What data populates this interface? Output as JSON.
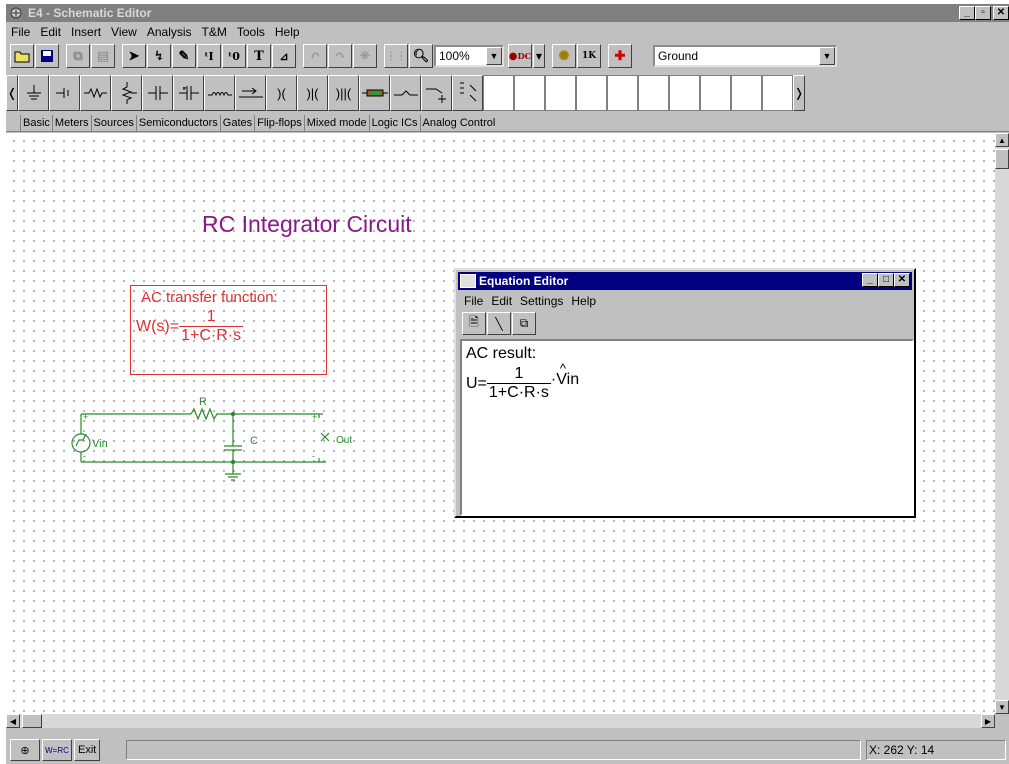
{
  "window": {
    "title": "E4 - Schematic Editor"
  },
  "menu": [
    "File",
    "Edit",
    "Insert",
    "View",
    "Analysis",
    "T&M",
    "Tools",
    "Help"
  ],
  "toolbar": {
    "zoom": "100%",
    "component_select": "Ground",
    "icon_names": [
      "open-icon",
      "save-icon",
      "copy-icon",
      "paste-icon",
      "select-arrow-icon",
      "wire-icon",
      "pen-icon",
      "text-subscript-icon",
      "text-zero-icon",
      "text-icon",
      "ac-source-icon",
      "undo-icon",
      "redo-icon",
      "crosshair-icon",
      "grid-icon",
      "zoom-icon",
      "dc-analysis-icon",
      "transient-icon",
      "kilo-icon",
      "probe-icon"
    ]
  },
  "component_tabs": [
    "Basic",
    "Meters",
    "Sources",
    "Semiconductors",
    "Gates",
    "Flip-flops",
    "Mixed mode",
    "Logic ICs",
    "Analog Control"
  ],
  "schematic": {
    "title": "RC Integrator Circuit",
    "transfer_box": {
      "heading": "AC transfer function:",
      "lhs": "W(s)=",
      "numerator": "1",
      "denominator": "1+C·R·s"
    },
    "labels": {
      "resistor": "R",
      "capacitor": "C",
      "source": "Vin",
      "output": "Out",
      "plus": "+",
      "minus": "-"
    }
  },
  "equation_editor": {
    "title": "Equation Editor",
    "menu": [
      "File",
      "Edit",
      "Settings",
      "Help"
    ],
    "result_label": "AC result:",
    "lhs": "U=",
    "numerator": "1",
    "denominator": "1+C·R·s",
    "factor": "·Vin",
    "hat": "^"
  },
  "statusbar": {
    "exit_label": "Exit",
    "coord": "X: 262  Y: 14",
    "formula_icon_text": "RC"
  },
  "colors": {
    "title": "#8a1a8a",
    "transfer_box": "#e03030",
    "circuit": "#2a8a2a"
  }
}
